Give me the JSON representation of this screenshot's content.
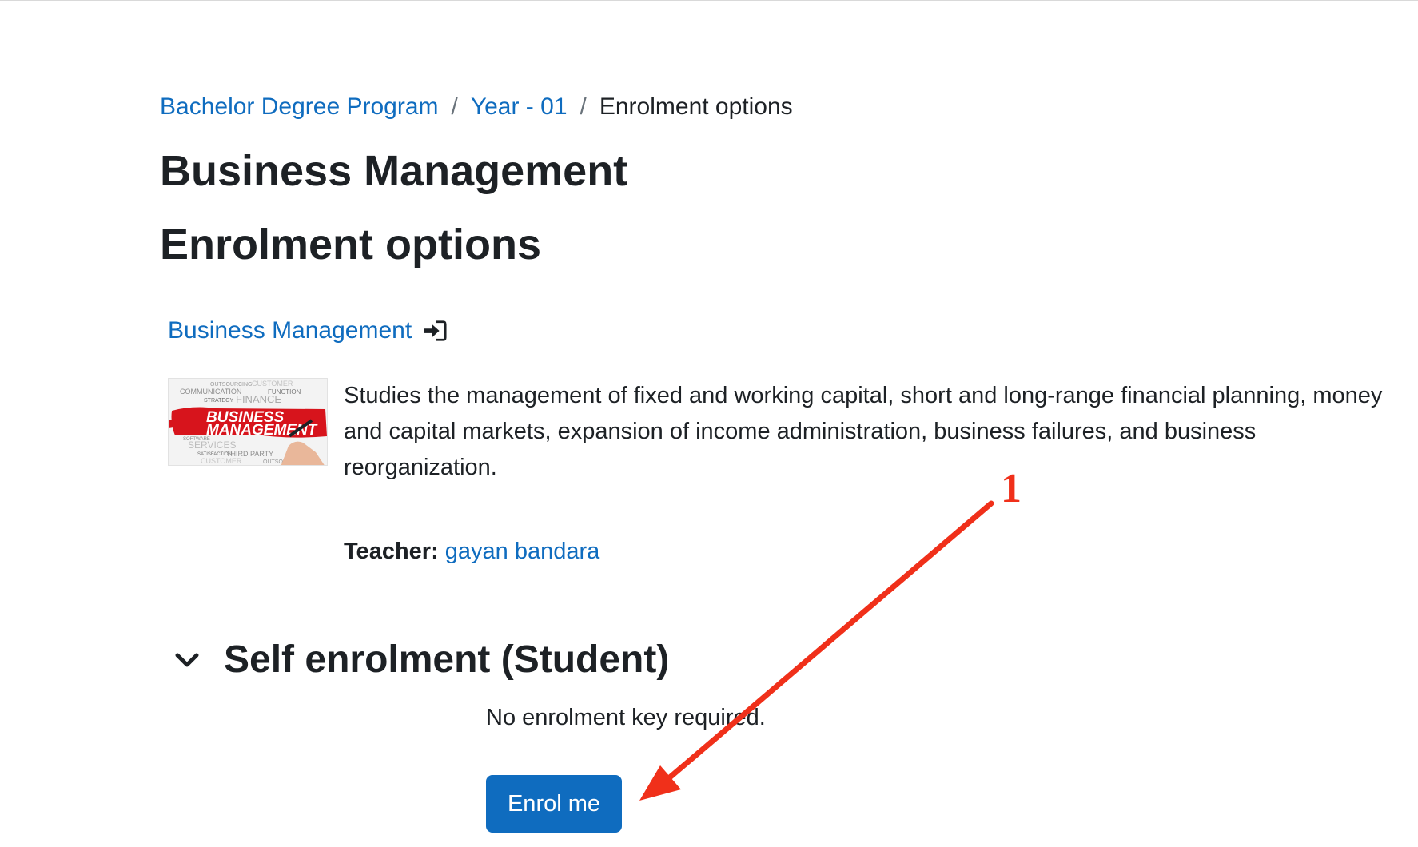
{
  "breadcrumb": {
    "items": [
      "Bachelor Degree Program",
      "Year - 01"
    ],
    "current": "Enrolment options",
    "separator": "/"
  },
  "course": {
    "title": "Business Management",
    "link_label": "Business Management",
    "summary": "Studies the management of fixed and working capital, short and long-range financial planning, money and capital markets, expansion of income administration, business failures, and business reorganization.",
    "teacher_label": "Teacher:",
    "teacher_name": "gayan bandara",
    "image": {
      "headline_1": "BUSINESS",
      "headline_2": "MANAGEMENT",
      "words": [
        "OUTSOURCING",
        "CUSTOMER",
        "COMMUNICATION",
        "FUNCTION",
        "STRATEGY",
        "FINANCE",
        "SOFTWARE",
        "SERVICES",
        "SATISFACTION",
        "THIRD PARTY",
        "CUSTOMER",
        "OUTSOURCING"
      ]
    }
  },
  "page": {
    "heading": "Enrolment options"
  },
  "self_enrolment": {
    "title": "Self enrolment (Student)",
    "note": "No enrolment key required.",
    "button_label": "Enrol me"
  },
  "annotation": {
    "label": "1",
    "color": "#f0301a"
  },
  "colors": {
    "link": "#0f6cbf",
    "primary_button": "#0f6cbf",
    "text": "#1d2125"
  },
  "icons": {
    "course_link": "login-icon",
    "section_toggle": "chevron-down-icon",
    "annotation": "arrow-icon"
  }
}
